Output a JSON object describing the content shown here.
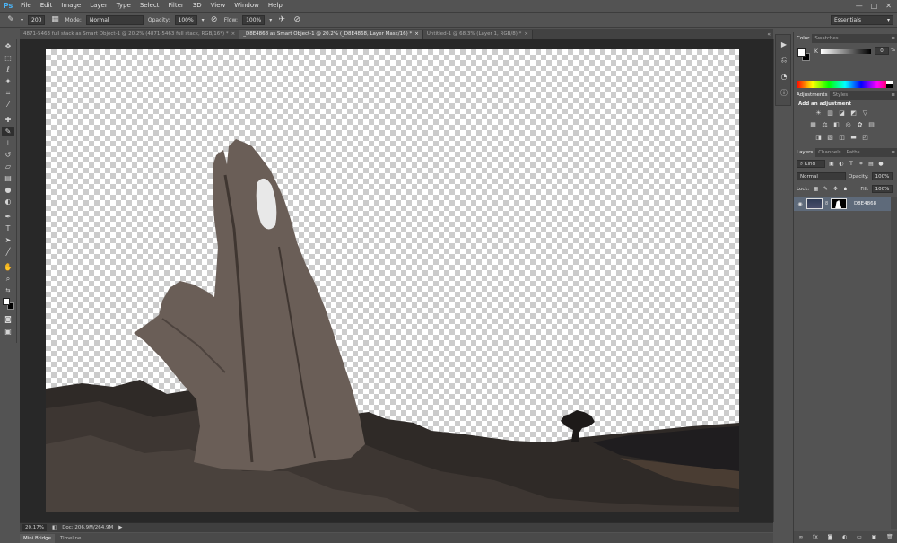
{
  "app": {
    "logo": "Ps"
  },
  "menu": [
    "File",
    "Edit",
    "Image",
    "Layer",
    "Type",
    "Select",
    "Filter",
    "3D",
    "View",
    "Window",
    "Help"
  ],
  "window_controls": {
    "minimize": "—",
    "maximize": "□",
    "close": "✕"
  },
  "options": {
    "brush_size": "200",
    "mode_label": "Mode:",
    "mode_value": "Normal",
    "opacity_label": "Opacity:",
    "opacity_value": "100%",
    "flow_label": "Flow:",
    "flow_value": "100%",
    "workspace": "Essentials"
  },
  "tabs": [
    {
      "label": "4871-5463 full stack as Smart Object-1 @ 20.2% (4871-5463 full stack, RGB/16*) *",
      "close": "×"
    },
    {
      "label": "_D8E4868 as Smart Object-1 @ 20.2% (_D8E4868, Layer Mask/16) *",
      "close": "×"
    },
    {
      "label": "Untitled-1 @ 68.3% (Layer 1, RGB/8) *",
      "close": "×"
    }
  ],
  "tabs_collapse": "«",
  "status": {
    "zoom": "20.17%",
    "doc": "Doc: 206.9M/264.9M",
    "arrow": "▶"
  },
  "bottom_tabs": [
    "Mini Bridge",
    "Timeline"
  ],
  "color_panel": {
    "tabs": [
      "Color",
      "Swatches"
    ],
    "channel_label": "K",
    "channel_value": "0",
    "percent": "%",
    "fg_color": "#ffffff",
    "bg_color": "#000000"
  },
  "adjustments_panel": {
    "tabs": [
      "Adjustments",
      "Styles"
    ],
    "title": "Add an adjustment"
  },
  "layers_panel": {
    "tabs": [
      "Layers",
      "Channels",
      "Paths"
    ],
    "filter": "Kind",
    "blend_mode": "Normal",
    "opacity_label": "Opacity:",
    "opacity_value": "100%",
    "lock_label": "Lock:",
    "fill_label": "Fill:",
    "fill_value": "100%",
    "layers": [
      {
        "name": "_D8E4868",
        "visible": true
      }
    ]
  },
  "panel_menu_glyph": "≡",
  "icons": {
    "tools": [
      "move-icon",
      "marquee-icon",
      "lasso-icon",
      "quick-select-icon",
      "crop-icon",
      "eyedropper-icon",
      "healing-icon",
      "brush-icon",
      "clone-stamp-icon",
      "history-brush-icon",
      "eraser-icon",
      "gradient-icon",
      "blur-icon",
      "dodge-icon",
      "pen-icon",
      "type-icon",
      "path-select-icon",
      "line-icon",
      "hand-icon",
      "zoom-icon"
    ]
  }
}
